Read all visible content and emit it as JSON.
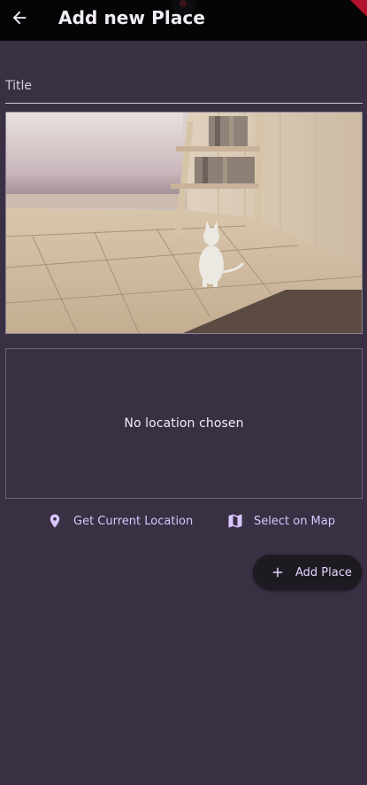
{
  "appbar": {
    "title": "Add new Place",
    "back_icon": "arrow-back-icon"
  },
  "form": {
    "title_placeholder": "Title",
    "title_value": ""
  },
  "image_preview": {
    "icon": "photo-preview"
  },
  "location": {
    "empty_text": "No location chosen"
  },
  "actions": {
    "current_location_label": "Get Current Location",
    "current_location_icon": "location-pin-icon",
    "select_map_label": "Select on Map",
    "select_map_icon": "map-icon"
  },
  "add_button": {
    "label": "Add Place",
    "icon": "plus-icon"
  },
  "colors": {
    "background": "#393043",
    "appbar": "#050505",
    "accent": "#d9c6ff",
    "button_bg": "#1d1a22"
  }
}
